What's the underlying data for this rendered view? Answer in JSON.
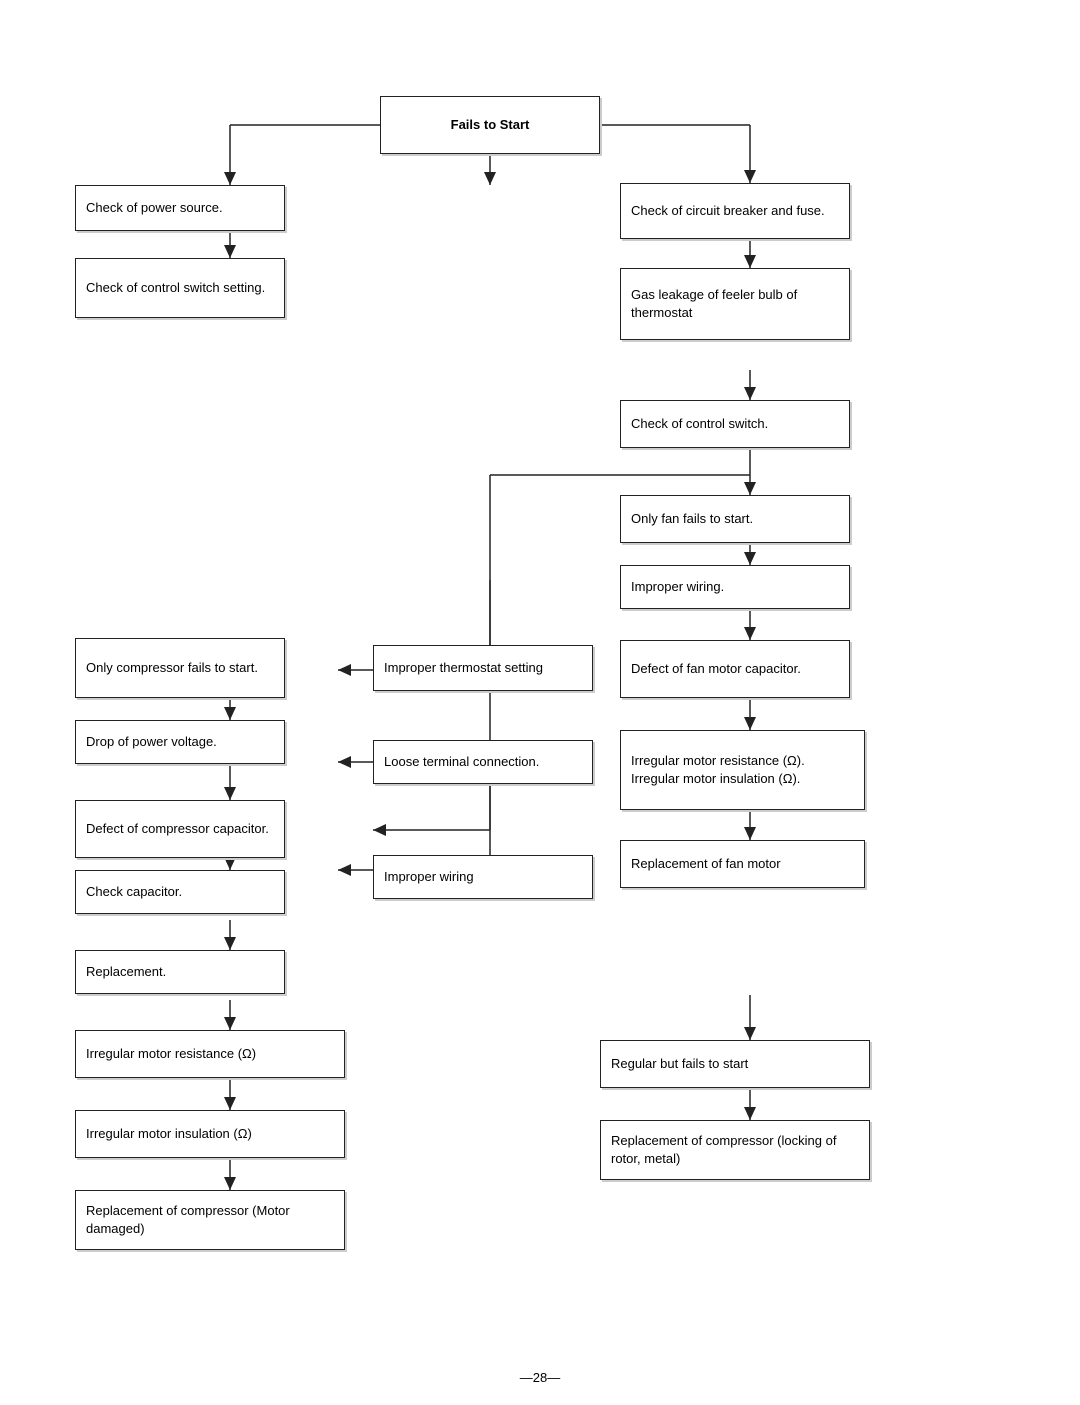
{
  "title": "Fails to Start",
  "boxes": {
    "fails_to_start": {
      "label": "Fails to Start"
    },
    "check_power": {
      "label": "Check of power source."
    },
    "check_control_switch_setting": {
      "label": "Check of control switch setting."
    },
    "check_circuit_breaker": {
      "label": "Check of circuit breaker and fuse."
    },
    "gas_leakage": {
      "label": "Gas leakage of feeler bulb of thermostat"
    },
    "check_control_switch": {
      "label": "Check of control switch."
    },
    "only_fan_fails": {
      "label": "Only fan fails to start."
    },
    "improper_wiring_right": {
      "label": "Improper wiring."
    },
    "defect_fan_capacitor": {
      "label": "Defect of fan motor capacitor."
    },
    "irregular_motor_right": {
      "label": "Irregular motor resistance (Ω).\nIrregular motor insulation (Ω)."
    },
    "replacement_fan_motor": {
      "label": "Replacement of fan motor"
    },
    "only_compressor_fails": {
      "label": "Only compressor fails to start."
    },
    "drop_power_voltage": {
      "label": "Drop of power voltage."
    },
    "defect_compressor_cap": {
      "label": "Defect of compressor capacitor."
    },
    "check_capacitor": {
      "label": "Check capacitor."
    },
    "replacement": {
      "label": "Replacement."
    },
    "improper_thermostat": {
      "label": "Improper thermostat setting"
    },
    "loose_terminal": {
      "label": "Loose terminal connection."
    },
    "improper_wiring_mid": {
      "label": "Improper wiring"
    },
    "irregular_motor_resistance_bottom": {
      "label": "Irregular motor resistance (Ω)"
    },
    "irregular_motor_insulation_bottom": {
      "label": "Irregular motor insulation (Ω)"
    },
    "replacement_compressor_motor": {
      "label": "Replacement of compressor (Motor damaged)"
    },
    "regular_fails": {
      "label": "Regular but fails to start"
    },
    "replacement_compressor_rotor": {
      "label": "Replacement of compressor (locking of rotor, metal)"
    }
  },
  "page_number": "—28—"
}
